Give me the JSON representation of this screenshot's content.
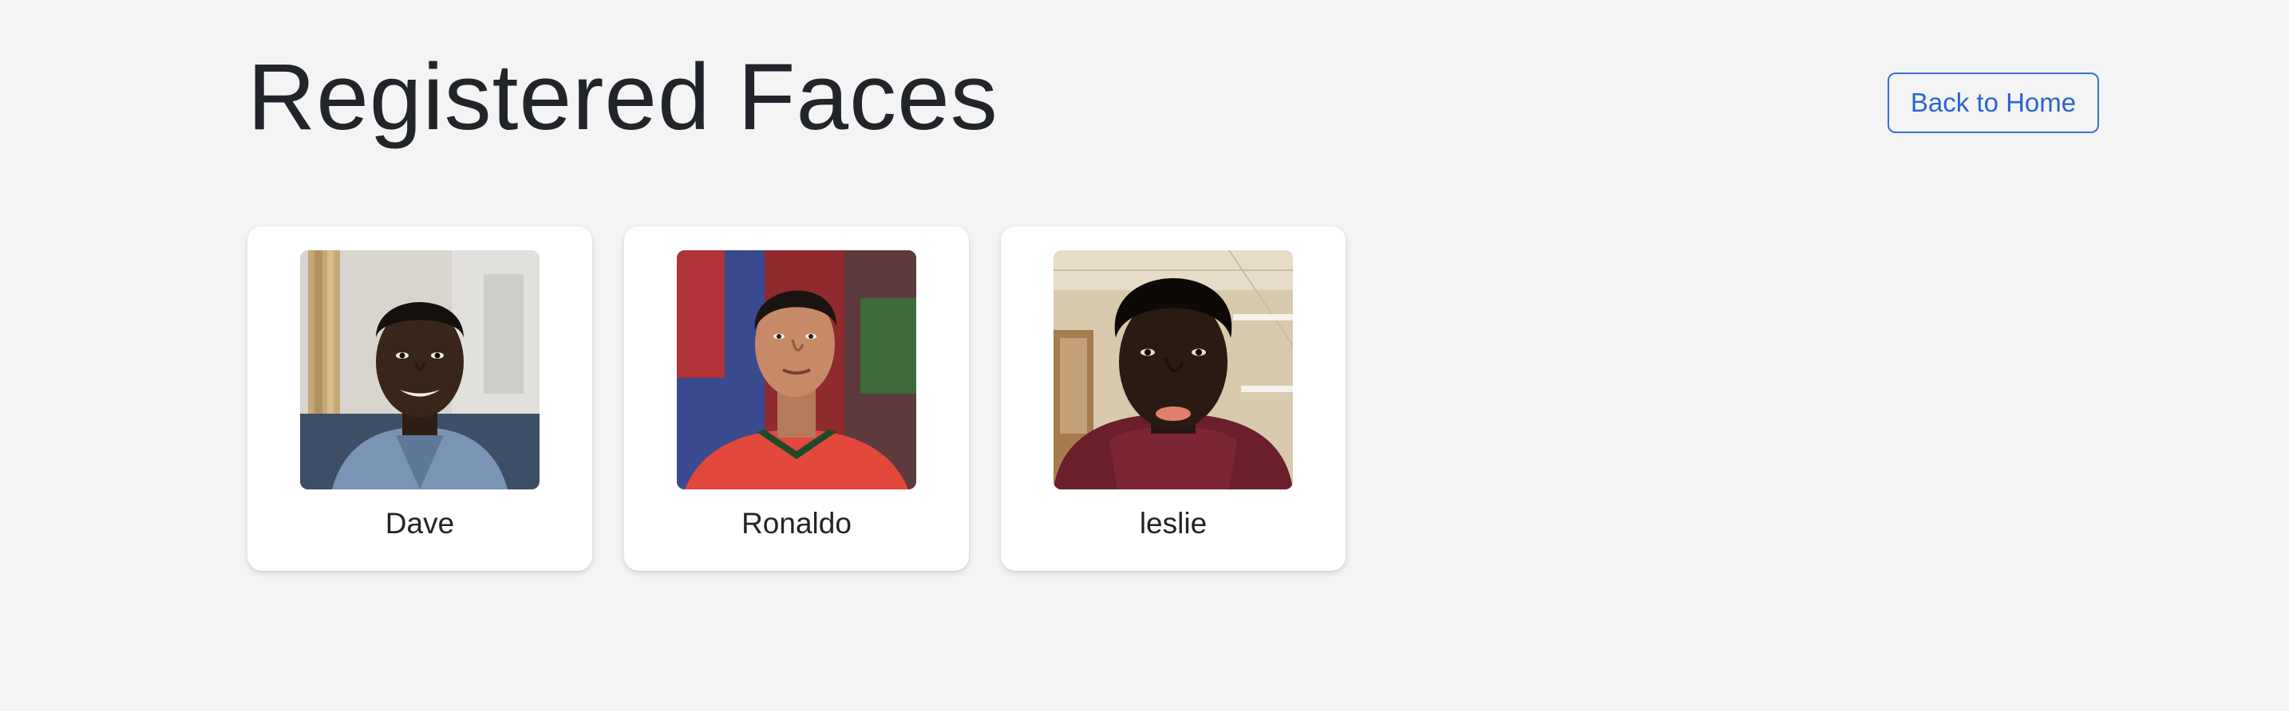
{
  "header": {
    "title": "Registered Faces",
    "back_button_label": "Back to Home"
  },
  "faces": [
    {
      "name": "Dave"
    },
    {
      "name": "Ronaldo"
    },
    {
      "name": "leslie"
    }
  ],
  "colors": {
    "page_background": "#f4f4f4",
    "card_background": "#ffffff",
    "text": "#212529",
    "accent": "#2d63d0"
  }
}
